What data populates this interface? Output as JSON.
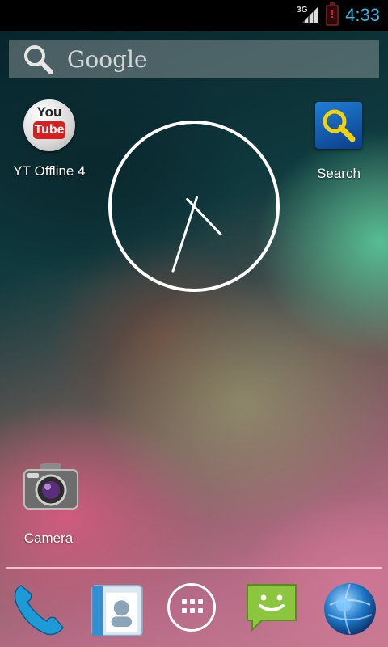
{
  "status_bar": {
    "network_label": "3G",
    "time": "4:33",
    "battery_alert": "!"
  },
  "search_widget": {
    "label": "Google"
  },
  "home_apps": [
    {
      "label": "YT Offline 4",
      "icon": "youtube-icon",
      "icon_text_top": "You",
      "icon_text_bottom": "Tube"
    },
    {
      "label": "Search",
      "icon": "magnifier-icon"
    },
    {
      "label": "Camera",
      "icon": "camera-icon"
    }
  ],
  "analog_clock": {
    "hour": 4,
    "minute": 33
  },
  "dock": [
    {
      "name": "phone",
      "icon": "phone-icon"
    },
    {
      "name": "contacts",
      "icon": "contacts-icon"
    },
    {
      "name": "all-apps",
      "icon": "app-drawer-icon"
    },
    {
      "name": "messaging",
      "icon": "messaging-icon"
    },
    {
      "name": "browser",
      "icon": "globe-icon"
    }
  ],
  "colors": {
    "status_accent": "#33b5e5",
    "battery_alert": "#e02020"
  }
}
